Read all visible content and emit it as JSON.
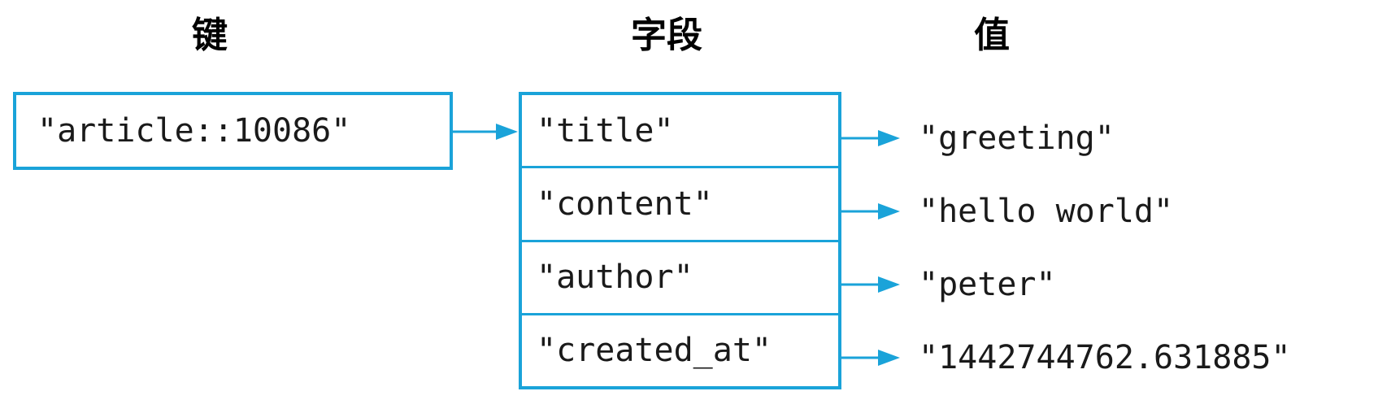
{
  "headers": {
    "key": "键",
    "field": "字段",
    "value": "值"
  },
  "key": "\"article::10086\"",
  "rows": [
    {
      "field": "\"title\"",
      "value": "\"greeting\""
    },
    {
      "field": "\"content\"",
      "value": "\"hello world\""
    },
    {
      "field": "\"author\"",
      "value": "\"peter\""
    },
    {
      "field": "\"created_at\"",
      "value": "\"1442744762.631885\""
    }
  ],
  "colors": {
    "accent": "#1aa3d9",
    "text": "#1a1a1a"
  }
}
